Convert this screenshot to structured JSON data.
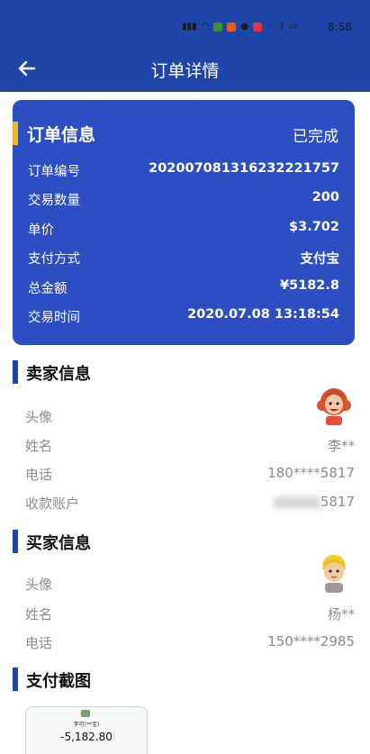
{
  "status_bar": {
    "time": "8:58"
  },
  "header": {
    "title": "订单详情"
  },
  "order": {
    "title": "订单信息",
    "status": "已完成",
    "rows": [
      {
        "label": "订单编号",
        "value": "20200708131623222175​7"
      },
      {
        "label": "交易数量",
        "value": "200"
      },
      {
        "label": "单价",
        "value": "$3.702"
      },
      {
        "label": "支付方式",
        "value": "支付宝"
      },
      {
        "label": "总金额",
        "value": "¥5182.8"
      },
      {
        "label": "交易时间",
        "value": "2020.07.08 13:18:54"
      }
    ]
  },
  "seller": {
    "title": "卖家信息",
    "avatar_label": "头像",
    "name_label": "姓名",
    "name": "李**",
    "phone_label": "电话",
    "phone": "180****5817",
    "account_label": "收款账户",
    "account": "5817"
  },
  "buyer": {
    "title": "买家信息",
    "avatar_label": "头像",
    "name_label": "姓名",
    "name": "杨**",
    "phone_label": "电话",
    "phone": "150****2985"
  },
  "payment": {
    "title": "支付截图",
    "screenshot_name": "李可(**宝)",
    "screenshot_amount": "-5,182.80"
  },
  "colors": {
    "header": "#1d46a8",
    "card": "#2b4fc3",
    "accent": "#f2b624"
  }
}
